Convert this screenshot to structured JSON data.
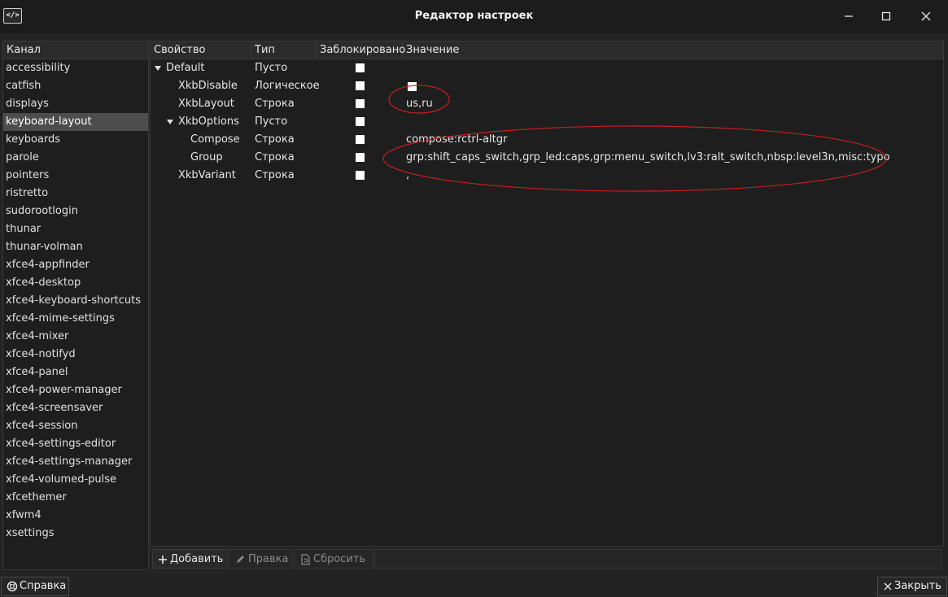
{
  "window": {
    "title": "Редактор настроек",
    "icon_text": "</>"
  },
  "channels": {
    "header": "Канал",
    "items": [
      "accessibility",
      "catfish",
      "displays",
      "keyboard-layout",
      "keyboards",
      "parole",
      "pointers",
      "ristretto",
      "sudorootlogin",
      "thunar",
      "thunar-volman",
      "xfce4-appfinder",
      "xfce4-desktop",
      "xfce4-keyboard-shortcuts",
      "xfce4-mime-settings",
      "xfce4-mixer",
      "xfce4-notifyd",
      "xfce4-panel",
      "xfce4-power-manager",
      "xfce4-screensaver",
      "xfce4-session",
      "xfce4-settings-editor",
      "xfce4-settings-manager",
      "xfce4-volumed-pulse",
      "xfcethemer",
      "xfwm4",
      "xsettings"
    ],
    "selected": "keyboard-layout"
  },
  "properties": {
    "columns": [
      "Свойство",
      "Тип",
      "Заблокировано",
      "Значение"
    ],
    "rows": [
      {
        "name": "Default",
        "type": "Пусто",
        "value": ""
      },
      {
        "name": "XkbDisable",
        "type": "Логическое",
        "value": ""
      },
      {
        "name": "XkbLayout",
        "type": "Строка",
        "value": "us,ru"
      },
      {
        "name": "XkbOptions",
        "type": "Пусто",
        "value": ""
      },
      {
        "name": "Compose",
        "type": "Строка",
        "value": "compose:rctrl-altgr"
      },
      {
        "name": "Group",
        "type": "Строка",
        "value": "grp:shift_caps_switch,grp_led:caps,grp:menu_switch,lv3:ralt_switch,nbsp:level3n,misc:typo"
      },
      {
        "name": "XkbVariant",
        "type": "Строка",
        "value": ","
      }
    ]
  },
  "toolbar": {
    "add": "Добавить",
    "edit": "Правка",
    "reset": "Сбросить"
  },
  "footer": {
    "help": "Справка",
    "close": "Закрыть"
  },
  "colors": {
    "background": "#232323",
    "selection": "#4d4d4d",
    "annotation": "#c81e1e"
  }
}
